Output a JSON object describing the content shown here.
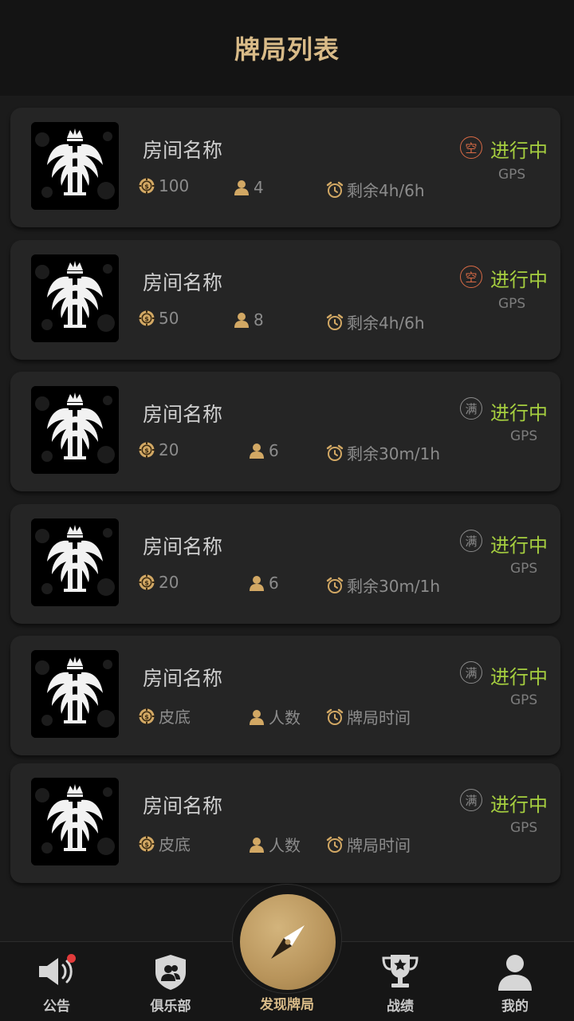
{
  "header": {
    "title": "牌局列表"
  },
  "rooms": [
    {
      "name": "房间名称",
      "chip": "100",
      "players": "4",
      "time": "剩余4h/6h",
      "occupancy": "空",
      "occupancy_type": "empty",
      "status": "进行中",
      "gps": "GPS"
    },
    {
      "name": "房间名称",
      "chip": "50",
      "players": "8",
      "time": "剩余4h/6h",
      "occupancy": "空",
      "occupancy_type": "empty",
      "status": "进行中",
      "gps": "GPS"
    },
    {
      "name": "房间名称",
      "chip": "20",
      "players": "6",
      "time": "剩余30m/1h",
      "occupancy": "满",
      "occupancy_type": "full",
      "status": "进行中",
      "gps": "GPS"
    },
    {
      "name": "房间名称",
      "chip": "20",
      "players": "6",
      "time": "剩余30m/1h",
      "occupancy": "满",
      "occupancy_type": "full",
      "status": "进行中",
      "gps": "GPS"
    },
    {
      "name": "房间名称",
      "chip": "皮底",
      "players": "人数",
      "time": "牌局时间",
      "occupancy": "满",
      "occupancy_type": "full",
      "status": "进行中",
      "gps": "GPS"
    },
    {
      "name": "房间名称",
      "chip": "皮底",
      "players": "人数",
      "time": "牌局时间",
      "occupancy": "满",
      "occupancy_type": "full",
      "status": "进行中",
      "gps": "GPS"
    }
  ],
  "nav": {
    "announcement": "公告",
    "club": "俱乐部",
    "discover": "发现牌局",
    "record": "战绩",
    "mine": "我的"
  },
  "colors": {
    "accent_gold": "#d9bb88",
    "status_green": "#a6cf3f",
    "empty_orange": "#d86a45",
    "notification_red": "#e23b3b"
  },
  "icons": {
    "chip": "chip-icon",
    "players": "person-icon",
    "time": "alarm-clock-icon",
    "announcement": "speaker-icon",
    "club": "shield-icon",
    "discover": "compass-icon",
    "record": "trophy-icon",
    "mine": "user-icon"
  }
}
